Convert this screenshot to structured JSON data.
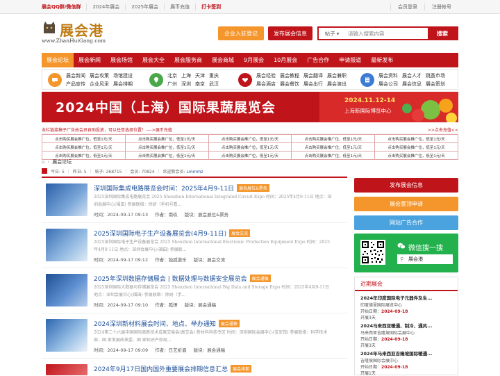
{
  "topbar": {
    "left": [
      "展会QQ群/微信群",
      "2024年展会",
      "2025年展会",
      "展币充值",
      "打卡签到"
    ],
    "right": [
      "会员登录",
      "注册帐号"
    ]
  },
  "logo": {
    "text": "展会港",
    "url_text": "www.ZhanHuiGang.com"
  },
  "header": {
    "register_btn": "企业入驻登记",
    "publish_btn": "发布展会信息"
  },
  "search": {
    "type": "帖子",
    "placeholder": "请输入搜索内容",
    "button": "搜索"
  },
  "nav": [
    "展会论坛",
    "展会新闻",
    "展会场馆",
    "展会大全",
    "展会服务商",
    "展会商城",
    "9月展会",
    "10月展会",
    "广告合作",
    "申请报道",
    "最新发布"
  ],
  "cats": {
    "g1": [
      "展会新闻",
      "产品宣传",
      "展会攻策",
      "企业风采",
      "场馆建设",
      "展会排期"
    ],
    "g2": [
      "北京",
      "广州",
      "上海",
      "深圳",
      "天津",
      "南京",
      "重庆",
      "武汉"
    ],
    "g3": [
      "展会经验",
      "展会酒店",
      "展会教程",
      "展会餐饮",
      "展会翻译",
      "展会出行",
      "展会兼职",
      "展会演出"
    ],
    "g4": [
      "展会资料",
      "展会公司",
      "展会人才",
      "展会信息",
      "跳蚤市场",
      "展会策划"
    ]
  },
  "banner": {
    "title": "2024中国（上海）国际果蔬展览会",
    "date": "2024.11.12-14",
    "venue": "上海新国际博览中心"
  },
  "ticker": {
    "left": "本栏链接稿子广告由会员自助投放，可以任意选择位置！---->展币充值",
    "right": ">>点击充值<<"
  },
  "ad_cell": "点击购买展会推广位，低至1元/天",
  "breadcrumb": "展会论坛",
  "stats": {
    "today_label": "今日:",
    "today": "5",
    "yesterday_label": "昨日:",
    "yesterday": "5",
    "posts_label": "帖子:",
    "posts": "268715",
    "members_label": "会员:",
    "members": "70824",
    "welcome": "欢迎新会员:",
    "newest": "Lmmmz"
  },
  "posts": [
    {
      "title": "深圳国际集成电路展览会时间：2025年4月9-11日",
      "tag": "展会展位&票务",
      "desc": "2025深圳国际集成电路展览会 2025 Shenzhen International Integrated Circuit Expo 时间：2025年4月9-11日 地点：深圳会展中心(福田) 参展联络：徐妍（手机号看...",
      "time": "时间：2024-09-17 09:13",
      "author": "作者：南玖",
      "board": "版块：展会展位&票务"
    },
    {
      "title": "2025深圳国际电子生产设备展览会(4月9-11日)",
      "tag": "展会交流",
      "desc": "2025深圳国际电子生产设备展览会 2025 Shenzhen International Electronic Production Equipment Expo 时间：2025年4月9-11日 地点：深圳会展中心(福田) 参展联...",
      "time": "时间：2024-09-17 09:12",
      "author": "作者：独孤激乐",
      "board": "版块：展会交流"
    },
    {
      "title": "2025年深圳数据存储展会 | 数据处理与数据安全展览会",
      "tag": "展会通稿",
      "desc": "2025深圳国际大数据与存储展览会 2025 Shenzhen International Big Data and Storage Expo 时间：2025年4月9-11日 地点：深圳会展中心(福田) 参展联络：徐妍（手...",
      "time": "时间：2024-09-17 09:10",
      "author": "作者：孤燎",
      "board": "版块：展会通稿"
    },
    {
      "title": "2024深圳新材料展会时间、地点、举办通知",
      "tag": "展会通稿",
      "desc": "2024第二十六届中国国际高新技术成果交易会(高交会) 新材料科技专区 时间：深圳国际会展中心(宝安馆) 参展联络：科学技术部、国 家发展改革委、国 家知识产权局...",
      "time": "时间：2024-09-17 09:09",
      "author": "作者：日艺折眉",
      "board": "版块：展会通稿"
    },
    {
      "title": "2024年9月17日国内国外重要展会排期信息汇总",
      "tag": "展会排期",
      "desc": "",
      "time": "",
      "author": "",
      "board": ""
    }
  ],
  "right": {
    "publish": "发布展会信息",
    "top": "展会置顶申请",
    "ad": "网站广告合作",
    "wechat_title": "微信搜一搜",
    "wechat_search": "展会港",
    "recent_title": "近期展会",
    "recent": [
      {
        "name": "2024年印度国际电子元器件及生...",
        "venue": "印度德里国际展览中心",
        "date_label": "开始日期：",
        "date": "2024-09-18",
        "dur": "开展3天"
      },
      {
        "name": "2024马来西亚暖通、制冷、通风...",
        "venue": "马来西亚吉隆坡国际会展中心",
        "date_label": "开始日期：",
        "date": "2024-09-18",
        "dur": "开展3天"
      },
      {
        "name": "2024年马来西亚吉隆坡国际暖通...",
        "venue": "吉隆坡国际会展中心",
        "date_label": "开始日期：",
        "date": "2024-09-18",
        "dur": "开展1天"
      }
    ]
  },
  "colors": {
    "brand_red": "#c0141b",
    "orange": "#f4962b",
    "green": "#22b14c",
    "blue": "#1d4f9a"
  }
}
